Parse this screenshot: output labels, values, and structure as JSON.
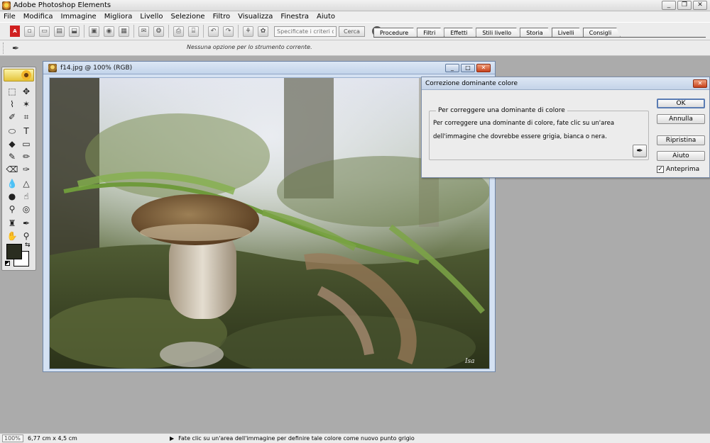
{
  "window": {
    "title": "Adobe Photoshop Elements",
    "controls": [
      "_",
      "❐",
      "✕"
    ]
  },
  "menu": [
    "File",
    "Modifica",
    "Immagine",
    "Migliora",
    "Livello",
    "Selezione",
    "Filtro",
    "Visualizza",
    "Finestra",
    "Aiuto"
  ],
  "toolbar": {
    "search_placeholder": "Specificate i criteri di ri",
    "search_button": "Cerca",
    "help": "?"
  },
  "palette_tabs": [
    "Procedure",
    "Filtri",
    "Effetti",
    "Stili livello",
    "Storia",
    "Livelli",
    "Consigli"
  ],
  "options_bar": {
    "message": "Nessuna opzione per lo strumento corrente."
  },
  "document": {
    "title": "f14.jpg @ 100% (RGB)",
    "watermark": "Isa"
  },
  "dialog": {
    "title": "Correzione dominante colore",
    "group_title": "Per correggere una dominante di colore",
    "instructions": "Per correggere una dominante di colore, fate clic su un'area dell'immagine che dovrebbe essere grigia, bianca o nera.",
    "buttons": {
      "ok": "OK",
      "cancel": "Annulla",
      "reset": "Ripristina",
      "help": "Aiuto"
    },
    "preview_label": "Anteprima",
    "preview_checked": true
  },
  "status": {
    "zoom": "100%",
    "doc_size": "6,77 cm x 4,5 cm",
    "message": "Fate clic su un'area dell'immagine per definire tale colore come nuovo punto grigio"
  },
  "colors": {
    "foreground": "#2a2d20",
    "background": "#ffffff"
  }
}
